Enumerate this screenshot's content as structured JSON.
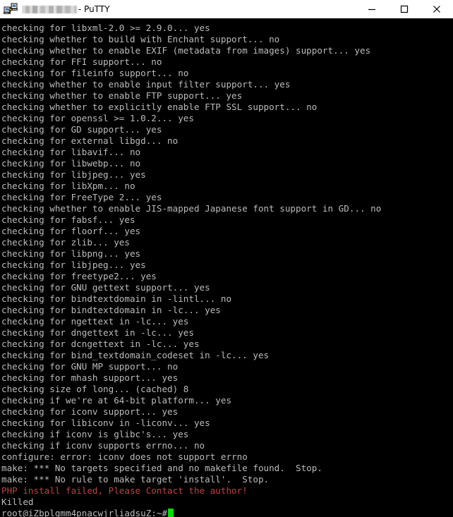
{
  "window": {
    "title_redacted": true,
    "title_suffix": "- PuTTY",
    "icon": "putty-icon",
    "controls": {
      "minimize": "minimize-icon",
      "maximize": "maximize-icon",
      "close": "close-icon"
    }
  },
  "terminal": {
    "background": "#000000",
    "foreground": "#bbbbbb",
    "error_color": "#bb4444",
    "cursor_color": "#00dd00",
    "prompt": "root@iZbplgmm4pnacwjrliadsuZ:~#",
    "lines": [
      {
        "text": "checking for libxml-2.0 >= 2.9.0... yes",
        "color": "default"
      },
      {
        "text": "checking whether to build with Enchant support... no",
        "color": "default"
      },
      {
        "text": "checking whether to enable EXIF (metadata from images) support... yes",
        "color": "default"
      },
      {
        "text": "checking for FFI support... no",
        "color": "default"
      },
      {
        "text": "checking for fileinfo support... no",
        "color": "default"
      },
      {
        "text": "checking whether to enable input filter support... yes",
        "color": "default"
      },
      {
        "text": "checking whether to enable FTP support... yes",
        "color": "default"
      },
      {
        "text": "checking whether to explicitly enable FTP SSL support... no",
        "color": "default"
      },
      {
        "text": "checking for openssl >= 1.0.2... yes",
        "color": "default"
      },
      {
        "text": "checking for GD support... yes",
        "color": "default"
      },
      {
        "text": "checking for external libgd... no",
        "color": "default"
      },
      {
        "text": "checking for libavif... no",
        "color": "default"
      },
      {
        "text": "checking for libwebp... no",
        "color": "default"
      },
      {
        "text": "checking for libjpeg... yes",
        "color": "default"
      },
      {
        "text": "checking for libXpm... no",
        "color": "default"
      },
      {
        "text": "checking for FreeType 2... yes",
        "color": "default"
      },
      {
        "text": "checking whether to enable JIS-mapped Japanese font support in GD... no",
        "color": "default"
      },
      {
        "text": "checking for fabsf... yes",
        "color": "default"
      },
      {
        "text": "checking for floorf... yes",
        "color": "default"
      },
      {
        "text": "checking for zlib... yes",
        "color": "default"
      },
      {
        "text": "checking for libpng... yes",
        "color": "default"
      },
      {
        "text": "checking for libjpeg... yes",
        "color": "default"
      },
      {
        "text": "checking for freetype2... yes",
        "color": "default"
      },
      {
        "text": "checking for GNU gettext support... yes",
        "color": "default"
      },
      {
        "text": "checking for bindtextdomain in -lintl... no",
        "color": "default"
      },
      {
        "text": "checking for bindtextdomain in -lc... yes",
        "color": "default"
      },
      {
        "text": "checking for ngettext in -lc... yes",
        "color": "default"
      },
      {
        "text": "checking for dngettext in -lc... yes",
        "color": "default"
      },
      {
        "text": "checking for dcngettext in -lc... yes",
        "color": "default"
      },
      {
        "text": "checking for bind_textdomain_codeset in -lc... yes",
        "color": "default"
      },
      {
        "text": "checking for GNU MP support... no",
        "color": "default"
      },
      {
        "text": "checking for mhash support... yes",
        "color": "default"
      },
      {
        "text": "checking size of long... (cached) 8",
        "color": "default"
      },
      {
        "text": "checking if we're at 64-bit platform... yes",
        "color": "default"
      },
      {
        "text": "checking for iconv support... yes",
        "color": "default"
      },
      {
        "text": "checking for libiconv in -liconv... yes",
        "color": "default"
      },
      {
        "text": "checking if iconv is glibc's... yes",
        "color": "default"
      },
      {
        "text": "checking if iconv supports errno... no",
        "color": "default"
      },
      {
        "text": "configure: error: iconv does not support errno",
        "color": "default"
      },
      {
        "text": "make: *** No targets specified and no makefile found.  Stop.",
        "color": "default"
      },
      {
        "text": "make: *** No rule to make target 'install'.  Stop.",
        "color": "default"
      },
      {
        "text": "PHP install failed, Please Contact the author!",
        "color": "red"
      },
      {
        "text": "Killed",
        "color": "default"
      }
    ]
  }
}
